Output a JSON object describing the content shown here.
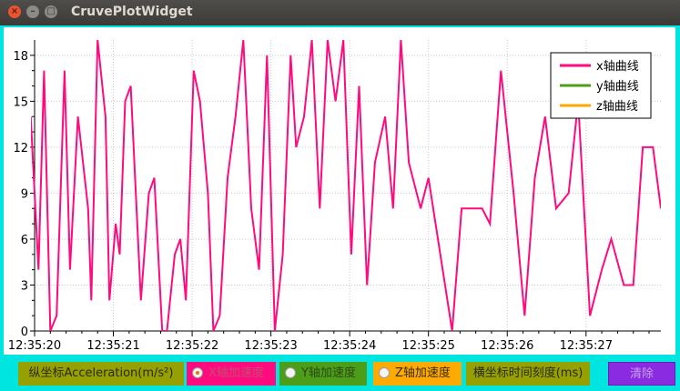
{
  "window": {
    "title": "CruvePlotWidget",
    "close_glyph": "×",
    "min_glyph": "–",
    "max_glyph": "□"
  },
  "legend": {
    "items": [
      {
        "label": "x轴曲线",
        "color": "#ff0a7f"
      },
      {
        "label": "y轴曲线",
        "color": "#4c9d1a"
      },
      {
        "label": "z轴曲线",
        "color": "#ffaa00"
      }
    ]
  },
  "controls": {
    "y_label": "纵坐标Acceleration(m/s²)",
    "x_radio": {
      "label": "X轴加速度",
      "checked": true,
      "bg": "#ff0a7f"
    },
    "y_radio": {
      "label": "Y轴加速度",
      "checked": false,
      "bg": "#4c9d1a"
    },
    "z_radio": {
      "label": "Z轴加速度",
      "checked": false,
      "bg": "#ffaa00"
    },
    "x_label": "横坐标时间刻度(ms)",
    "clear_button": "清除"
  },
  "chart_data": {
    "type": "line",
    "ylim": [
      0,
      19
    ],
    "yticks": [
      "0",
      "3",
      "6",
      "9",
      "12",
      "15",
      "18"
    ],
    "xticks": [
      "12:35:20",
      "12:35:21",
      "12:35:22",
      "12:35:23",
      "12:35:24",
      "12:35:25",
      "12:35:26",
      "12:35:27"
    ],
    "xlim": [
      0,
      7.95
    ],
    "grid": true,
    "legend_position": "top-right",
    "series": [
      {
        "name": "x轴曲线",
        "color": "#ff0a7f",
        "points": [
          [
            -0.05,
            14
          ],
          [
            0.05,
            4
          ],
          [
            0.12,
            17
          ],
          [
            0.2,
            0
          ],
          [
            0.28,
            1
          ],
          [
            0.38,
            17
          ],
          [
            0.45,
            4
          ],
          [
            0.55,
            14
          ],
          [
            0.68,
            8
          ],
          [
            0.72,
            2
          ],
          [
            0.8,
            19
          ],
          [
            0.9,
            14
          ],
          [
            0.95,
            2
          ],
          [
            1.03,
            7
          ],
          [
            1.08,
            5
          ],
          [
            1.15,
            15
          ],
          [
            1.22,
            16
          ],
          [
            1.35,
            2
          ],
          [
            1.45,
            9
          ],
          [
            1.52,
            10
          ],
          [
            1.62,
            0
          ],
          [
            1.68,
            0
          ],
          [
            1.78,
            5
          ],
          [
            1.85,
            6
          ],
          [
            1.92,
            2
          ],
          [
            2.02,
            17
          ],
          [
            2.1,
            15
          ],
          [
            2.2,
            9
          ],
          [
            2.27,
            0
          ],
          [
            2.35,
            1
          ],
          [
            2.45,
            10
          ],
          [
            2.55,
            14
          ],
          [
            2.65,
            19
          ],
          [
            2.75,
            8
          ],
          [
            2.85,
            4
          ],
          [
            2.95,
            18
          ],
          [
            3.05,
            0
          ],
          [
            3.15,
            5
          ],
          [
            3.25,
            18
          ],
          [
            3.32,
            12
          ],
          [
            3.42,
            14
          ],
          [
            3.52,
            19
          ],
          [
            3.62,
            8
          ],
          [
            3.72,
            19
          ],
          [
            3.82,
            15
          ],
          [
            3.92,
            19
          ],
          [
            4.02,
            5
          ],
          [
            4.12,
            16
          ],
          [
            4.22,
            3
          ],
          [
            4.32,
            11
          ],
          [
            4.45,
            14
          ],
          [
            4.55,
            8
          ],
          [
            4.65,
            19
          ],
          [
            4.75,
            11
          ],
          [
            4.9,
            8
          ],
          [
            5.0,
            10
          ],
          [
            5.3,
            0
          ],
          [
            5.42,
            8
          ],
          [
            5.68,
            8
          ],
          [
            5.78,
            7
          ],
          [
            5.92,
            17
          ],
          [
            6.08,
            9
          ],
          [
            6.22,
            1
          ],
          [
            6.35,
            10
          ],
          [
            6.48,
            14
          ],
          [
            6.62,
            8
          ],
          [
            6.78,
            9
          ],
          [
            6.9,
            15
          ],
          [
            7.05,
            1
          ],
          [
            7.2,
            4
          ],
          [
            7.32,
            6
          ],
          [
            7.48,
            3
          ],
          [
            7.6,
            3
          ],
          [
            7.72,
            12
          ],
          [
            7.85,
            12
          ],
          [
            7.95,
            8
          ]
        ]
      },
      {
        "name": "y轴曲线",
        "color": "#4c9d1a",
        "points": []
      },
      {
        "name": "z轴曲线",
        "color": "#ffaa00",
        "points": []
      }
    ]
  }
}
